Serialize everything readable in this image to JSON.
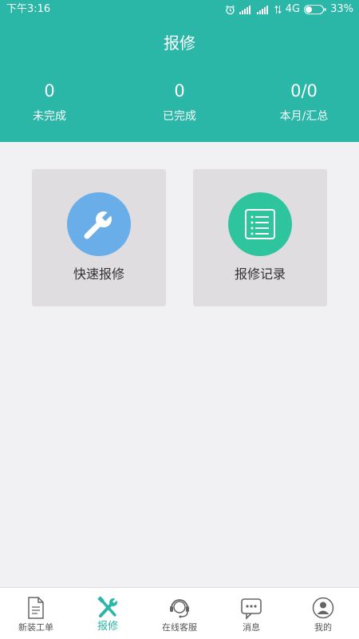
{
  "status_bar": {
    "time": "下午3:16",
    "network": "4G",
    "battery": "33%"
  },
  "header": {
    "title": "报修"
  },
  "stats": [
    {
      "value": "0",
      "label": "未完成"
    },
    {
      "value": "0",
      "label": "已完成"
    },
    {
      "value": "0/0",
      "label": "本月/汇总"
    }
  ],
  "cards": [
    {
      "label": "快速报修",
      "icon": "wrench-icon",
      "color": "#6aaee9"
    },
    {
      "label": "报修记录",
      "icon": "list-icon",
      "color": "#2ec49d"
    }
  ],
  "tabs": [
    {
      "label": "新装工单",
      "icon": "document-icon"
    },
    {
      "label": "报修",
      "icon": "tools-icon",
      "active": true
    },
    {
      "label": "在线客服",
      "icon": "headset-icon"
    },
    {
      "label": "消息",
      "icon": "chat-icon"
    },
    {
      "label": "我的",
      "icon": "user-icon"
    }
  ],
  "colors": {
    "accent": "#2ab7a8",
    "background": "#f1f0f2",
    "card": "#dfdddf"
  }
}
